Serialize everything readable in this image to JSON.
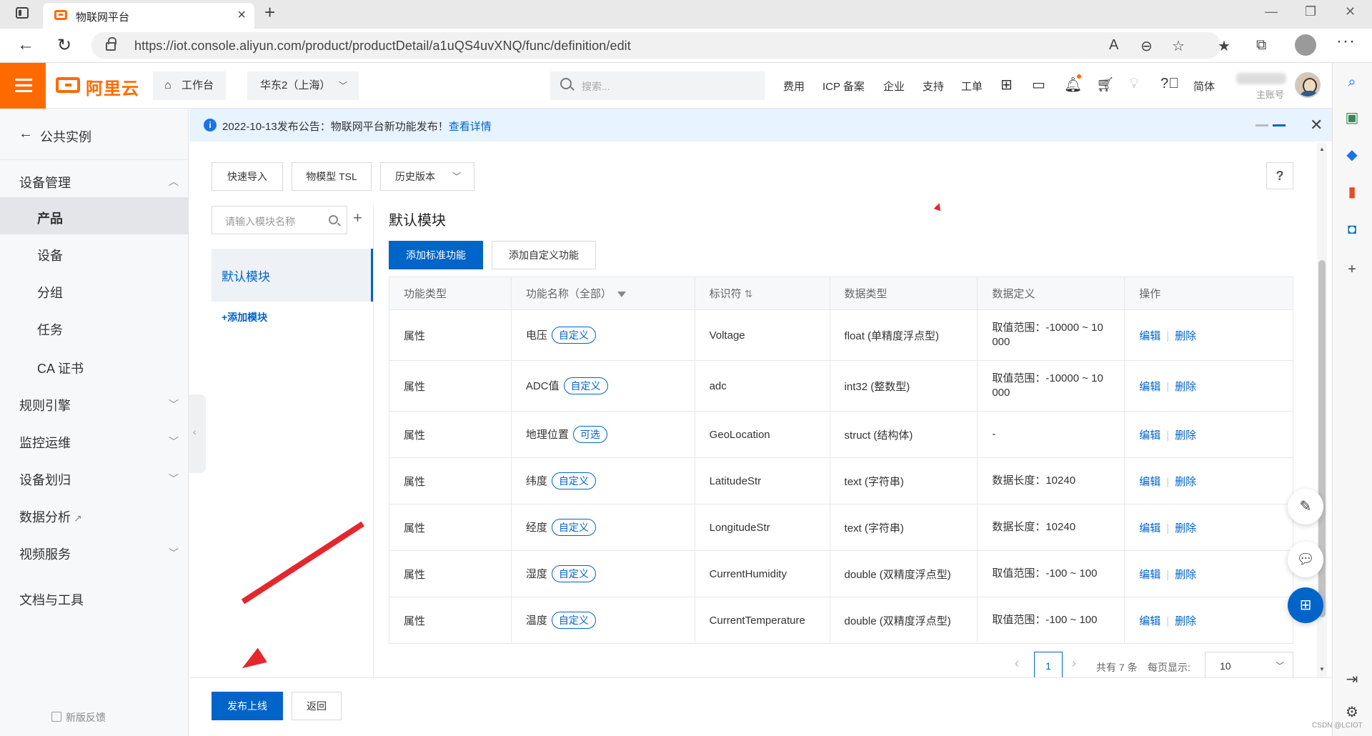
{
  "browser": {
    "tab_title": "物联网平台",
    "url": "https://iot.console.aliyun.com/product/productDetail/a1uQS4uvXNQ/func/definition/edit"
  },
  "topnav": {
    "logo_text": "阿里云",
    "workbench": "工作台",
    "region": "华东2（上海）",
    "search_placeholder": "搜索...",
    "links": [
      "费用",
      "ICP 备案",
      "企业",
      "支持",
      "工单"
    ],
    "lang": "简体",
    "account_label": "主账号"
  },
  "sidebar": {
    "back_label": "公共实例",
    "sections": {
      "device_mgmt": "设备管理",
      "rules": "规则引擎",
      "ops": "监控运维",
      "device_division": "设备划归",
      "analytics": "数据分析",
      "video": "视频服务",
      "docs": "文档与工具"
    },
    "items": [
      "产品",
      "设备",
      "分组",
      "任务",
      "CA 证书"
    ],
    "feedback": "新版反馈"
  },
  "notice": {
    "text": "2022-10-13发布公告：物联网平台新功能发布！",
    "link": "查看详情"
  },
  "toolbar": {
    "quick_import": "快速导入",
    "tsl": "物模型 TSL",
    "history": "历史版本",
    "help": "?"
  },
  "modules": {
    "search_placeholder": "请输入模块名称",
    "active": "默认模块",
    "add": "+添加模块"
  },
  "main": {
    "title": "默认模块",
    "add_standard": "添加标准功能",
    "add_custom": "添加自定义功能"
  },
  "table": {
    "headers": [
      "功能类型",
      "功能名称（全部）",
      "标识符",
      "数据类型",
      "数据定义",
      "操作"
    ],
    "edit_label": "编辑",
    "delete_label": "删除",
    "rows": [
      {
        "type": "属性",
        "name": "电压",
        "tag": "自定义",
        "id": "Voltage",
        "dtype": "float (单精度浮点型)",
        "def": "取值范围：-10000 ~ 10",
        "def2": "000"
      },
      {
        "type": "属性",
        "name": "ADC值",
        "tag": "自定义",
        "id": "adc",
        "dtype": "int32 (整数型)",
        "def": "取值范围：-10000 ~ 10",
        "def2": "000"
      },
      {
        "type": "属性",
        "name": "地理位置",
        "tag": "可选",
        "id": "GeoLocation",
        "dtype": "struct (结构体)",
        "def": "-",
        "def2": ""
      },
      {
        "type": "属性",
        "name": "纬度",
        "tag": "自定义",
        "id": "LatitudeStr",
        "dtype": "text (字符串)",
        "def": "数据长度：10240",
        "def2": ""
      },
      {
        "type": "属性",
        "name": "经度",
        "tag": "自定义",
        "id": "LongitudeStr",
        "dtype": "text (字符串)",
        "def": "数据长度：10240",
        "def2": ""
      },
      {
        "type": "属性",
        "name": "湿度",
        "tag": "自定义",
        "id": "CurrentHumidity",
        "dtype": "double (双精度浮点型)",
        "def": "取值范围：-100 ~ 100",
        "def2": ""
      },
      {
        "type": "属性",
        "name": "温度",
        "tag": "自定义",
        "id": "CurrentTemperature",
        "dtype": "double (双精度浮点型)",
        "def": "取值范围：-100 ~ 100",
        "def2": ""
      }
    ]
  },
  "pagination": {
    "current_page": "1",
    "total": "共有 7 条",
    "per_page_label": "每页显示:",
    "page_size": "10"
  },
  "footer": {
    "publish": "发布上线",
    "back": "返回"
  },
  "watermark": "CSDN @LCIOT",
  "colors": {
    "brand": "#ff6a00",
    "primary": "#0064c8",
    "annotation": "#e5262c"
  }
}
